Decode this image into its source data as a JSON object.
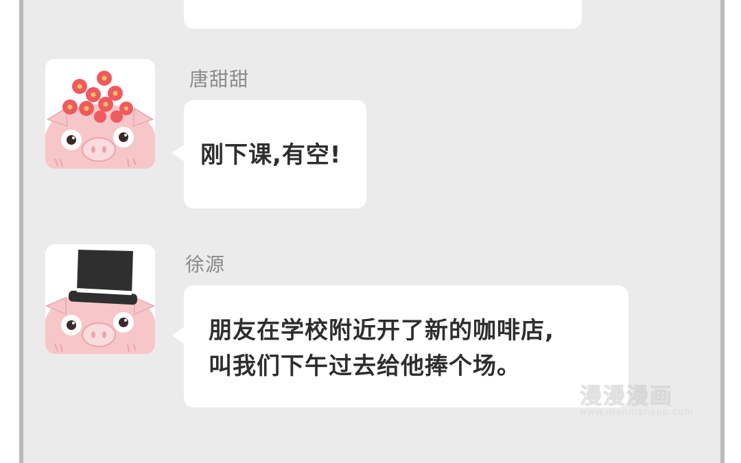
{
  "messages": [
    {
      "sender": "唐甜甜",
      "text": "刚下课,有空!",
      "avatar_icon": "pig-flower-crown-icon"
    },
    {
      "sender": "徐源",
      "text": "朋友在学校附近开了新的咖啡店,\n叫我们下午过去给他捧个场。",
      "avatar_icon": "pig-top-hat-icon"
    }
  ],
  "watermark": {
    "title": "漫漫漫画",
    "url": "www.manmanapp.com"
  },
  "colors": {
    "background": "#ebebeb",
    "bubble": "#ffffff",
    "frame": "#b9b9b9",
    "pig": "#f7c6c9",
    "flower": "#ef5a5f"
  }
}
